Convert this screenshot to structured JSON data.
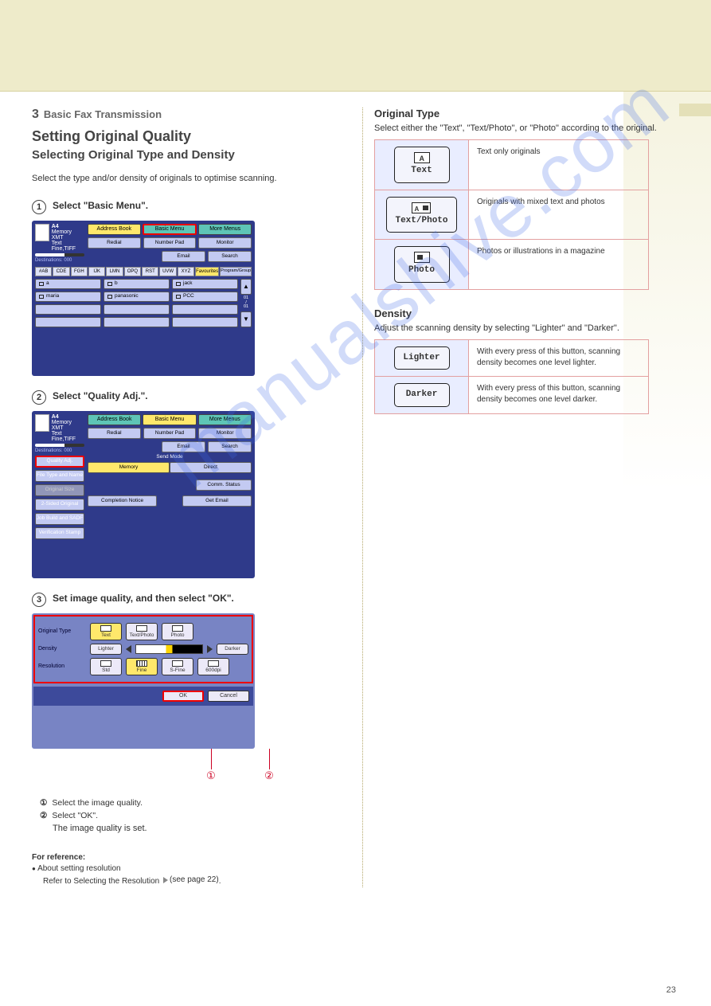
{
  "chapter": {
    "num": "3",
    "label": "Basic Fax Transmission"
  },
  "heading1": "Setting Original Quality",
  "heading2": "Selecting Original Type and Density",
  "intro": "Select the type and/or density of originals to optimise scanning.",
  "steps": {
    "s1": {
      "num": "1",
      "text": "Select \"Basic Menu\"."
    },
    "s2": {
      "num": "2",
      "text": "Select \"Quality Adj.\"."
    },
    "s3": {
      "num": "3",
      "text": "Set image quality, and then select \"OK\"."
    }
  },
  "p3_list": {
    "i1": {
      "n": "①",
      "t": "Select the image quality."
    },
    "i2": {
      "n": "②",
      "t": "Select \"OK\"."
    }
  },
  "after3": "The image quality is set.",
  "footnote": {
    "heading": "For reference:",
    "line1": "About setting resolution",
    "line1b": "Refer to Selecting the Resolution",
    "pageref1": "(see page 22)",
    "pend": "."
  },
  "panel1": {
    "status": {
      "size": "A4",
      "mode": "Memory XMT",
      "l1": "Text",
      "l2": "Fine,TIFF",
      "dest": "Destinations: 000"
    },
    "tabs": {
      "addr": "Address Book",
      "basic": "Basic Menu",
      "more": "More Menus"
    },
    "btns": {
      "redial": "Redial",
      "numpad": "Number Pad",
      "monitor": "Monitor",
      "email": "Email",
      "search": "Search"
    },
    "alpha": [
      "#AB",
      "CDE",
      "FGH",
      "IJK",
      "LMN",
      "OPQ",
      "RST",
      "UVW",
      "XYZ"
    ],
    "fav": "Favourites",
    "prog": "Program/Group",
    "addrs": [
      [
        "a",
        "b",
        "jack"
      ],
      [
        "maria",
        "panasonic",
        "PCC"
      ]
    ],
    "counter": "01\n/\n01"
  },
  "panel2": {
    "tabs": {
      "addr": "Address Book",
      "basic": "Basic Menu",
      "more": "More Menus"
    },
    "side": [
      "Quality Adj.",
      "File Type and Name",
      "Original Size",
      "2-Sided Original",
      "Job Build and SADF",
      "Verification Stamp"
    ],
    "main": {
      "sendmode": "Send Mode",
      "memory": "Memory",
      "direct": "Direct",
      "comm": "Comm. Status",
      "compnotice": "Completion Notice",
      "getemail": "Get Email"
    }
  },
  "panel3": {
    "rows": {
      "otype": "Original Type",
      "density": "Density",
      "res": "Resolution"
    },
    "otype": {
      "text": "Text",
      "tp": "Text/Photo",
      "photo": "Photo"
    },
    "density": {
      "lighter": "Lighter",
      "darker": "Darker"
    },
    "res": {
      "std": "Std",
      "fine": "Fine",
      "sfine": "S-Fine",
      "d600": "600dpi"
    },
    "ok": "OK",
    "cancel": "Cancel"
  },
  "right": {
    "otype_head": "Original Type",
    "otype_sub": "Select either the \"Text\", \"Text/Photo\", or \"Photo\" according to the original.",
    "table": {
      "text": {
        "label": "Text",
        "desc": "Text only originals"
      },
      "tp": {
        "label": "Text/Photo",
        "desc": "Originals with mixed text and photos"
      },
      "photo": {
        "label": "Photo",
        "desc": "Photos or illustrations in a magazine"
      }
    },
    "density_head": "Density",
    "density_sub": "Adjust the scanning density by selecting \"Lighter\" and \"Darker\".",
    "lighter": {
      "label": "Lighter",
      "desc": "With every press of this button, scanning density becomes one level lighter."
    },
    "darker": {
      "label": "Darker",
      "desc": "With every press of this button, scanning density becomes one level darker."
    }
  },
  "pagenum": "23"
}
